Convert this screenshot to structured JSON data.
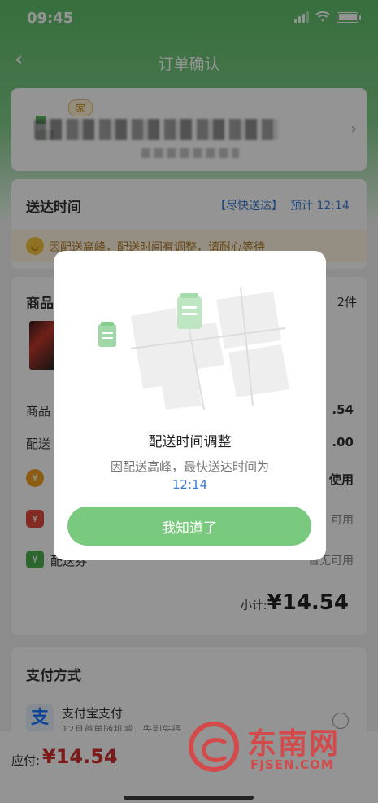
{
  "status": {
    "time": "09:45"
  },
  "nav": {
    "title": "订单确认"
  },
  "address": {
    "tag": "家"
  },
  "delivery": {
    "label": "送达时间",
    "mode": "【尽快送达】",
    "eta": "预计 12:14",
    "notice": "因配送高峰，配送时间有调整，请耐心等待"
  },
  "goods": {
    "title": "商品",
    "count": "2件",
    "rows": {
      "goods_amount_label": "商品",
      "goods_amount_value": ".54",
      "delivery_fee_label": "配送",
      "delivery_fee_value": ".00",
      "row3_value": "使用",
      "row4_value": "可用",
      "row5_label": "配送券",
      "row5_value": "暂无可用"
    },
    "icons": {
      "row3": "¥",
      "row4": "¥",
      "row5": "¥"
    },
    "subtotal_label": "小计:",
    "subtotal_value": "¥14.54"
  },
  "payment": {
    "title": "支付方式",
    "method": "支付宝支付",
    "promo": "12月首单随机减，先到先得",
    "icon": "支"
  },
  "footer": {
    "label": "应付:",
    "value": "¥14.54"
  },
  "modal": {
    "title": "配送时间调整",
    "desc": "因配送高峰，最快送达时间为",
    "time": "12:14",
    "button": "我知道了"
  },
  "watermark": {
    "text": "东南网",
    "sub": "FJSEN.COM"
  },
  "colors": {
    "brand_green": "#5fbf6a",
    "link_blue": "#3a7bd5",
    "price_red": "#d62d2d"
  }
}
